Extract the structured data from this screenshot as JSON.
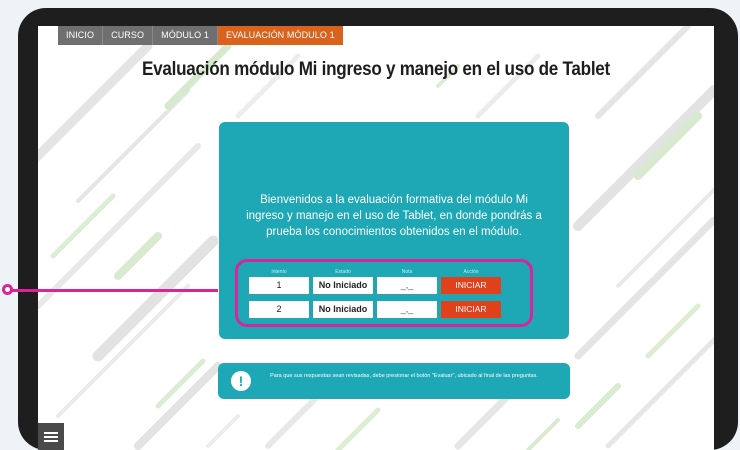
{
  "breadcrumb": [
    "INICIO",
    "CURSO",
    "MÓDULO 1",
    "EVALUACIÓN MÓDULO 1"
  ],
  "page_title": "Evaluación módulo Mi ingreso y manejo en el uso de Tablet",
  "welcome_text": "Bienvenidos a la evaluación formativa del módulo Mi ingreso y manejo en el uso de Tablet, en donde pondrás a prueba los conocimientos obtenidos en el módulo.",
  "columns": [
    "Intento",
    "Estado",
    "Nota",
    "Acción"
  ],
  "attempts": [
    {
      "intento": "1",
      "estado": "No Iniciado",
      "nota": "_,_",
      "accion": "INICIAR"
    },
    {
      "intento": "2",
      "estado": "No Iniciado",
      "nota": "_,_",
      "accion": "INICIAR"
    }
  ],
  "info_text": "Para que sus respuestas sean revisadas, debe presionar el botón \"Evaluar\", ubicado al final de las preguntas.",
  "icons": {
    "alert": "exclamation-icon",
    "menu": "menu-icon",
    "back": "back-arrow-icon"
  },
  "colors": {
    "teal": "#1ea7b5",
    "orange_tab": "#d9621c",
    "start_button": "#e0411b",
    "highlight": "#d9249a",
    "tablet_frame": "#1e1e1e"
  }
}
